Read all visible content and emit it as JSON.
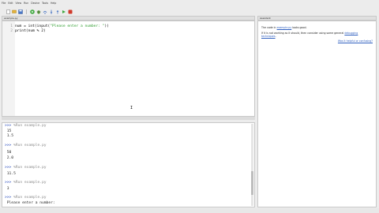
{
  "menu": [
    "File",
    "Edit",
    "View",
    "Run",
    "Device",
    "Tools",
    "Help"
  ],
  "toolbar_icons": [
    "new-icon",
    "open-icon",
    "save-icon",
    "run-icon",
    "debug-icon",
    "step-over-icon",
    "step-into-icon",
    "step-out-icon",
    "resume-icon",
    "stop-icon"
  ],
  "editor": {
    "tab_label": "example.py",
    "lines": [
      {
        "num": "1",
        "pre": "num = int(input(",
        "str": "\"Please enter a number: \"",
        "post": "))"
      },
      {
        "num": "2",
        "pre": "print(num % 2)",
        "str": "",
        "post": ""
      }
    ],
    "cursor_glyph": "I"
  },
  "shell": {
    "lines": [
      {
        "prompt": ">>> ",
        "cmd": "%Run example.py",
        "out": ""
      },
      {
        "prompt": "",
        "cmd": "",
        "out": " 15"
      },
      {
        "prompt": "",
        "cmd": "",
        "out": " 1.5"
      },
      {
        "prompt": ">>> ",
        "cmd": "%Run example.py",
        "out": ""
      },
      {
        "prompt": "",
        "cmd": "",
        "out": " 50"
      },
      {
        "prompt": "",
        "cmd": "",
        "out": " 2.0"
      },
      {
        "prompt": ">>> ",
        "cmd": "%Run example.py",
        "out": ""
      },
      {
        "prompt": "",
        "cmd": "",
        "out": " 11.5"
      },
      {
        "prompt": ">>> ",
        "cmd": "%Run example.py",
        "out": ""
      },
      {
        "prompt": "",
        "cmd": "",
        "out": " 3"
      },
      {
        "prompt": ">>> ",
        "cmd": "%Run example.py",
        "out": ""
      },
      {
        "prompt": "",
        "cmd": "",
        "out": " Please enter a number:"
      }
    ]
  },
  "assistant": {
    "tab_label": "Assistant",
    "line1_pre": "The code in ",
    "line1_link": "example.py",
    "line1_post": " looks good.",
    "line2_pre": "If it is not working as it should, then consider using some general ",
    "line2_link": "debugging techniques",
    "line2_post": ".",
    "footer_link": "Was it helpful or confusing?"
  }
}
